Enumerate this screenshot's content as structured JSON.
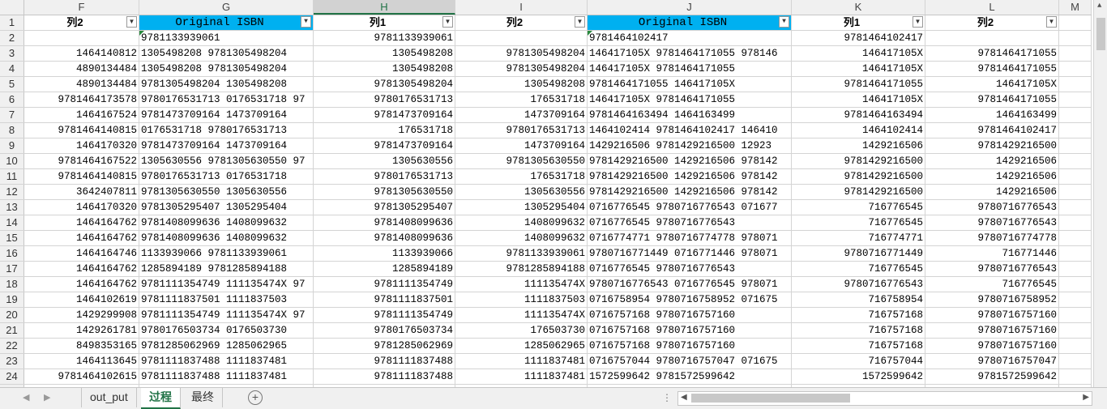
{
  "columns": [
    "F",
    "G",
    "H",
    "I",
    "J",
    "K",
    "L",
    "M"
  ],
  "selected_column": "H",
  "header_row": [
    "列2",
    "Original ISBN",
    "列1",
    "列2",
    "Original ISBN",
    "列1",
    "列2",
    ""
  ],
  "rows": [
    [
      "",
      "9781133939061",
      "9781133939061",
      "",
      "9781464102417",
      "9781464102417",
      ""
    ],
    [
      "1464140812",
      "1305498208  9781305498204",
      "1305498208",
      "9781305498204",
      "146417105X  9781464171055  978146",
      "146417105X",
      "9781464171055"
    ],
    [
      "4890134484",
      "1305498208  9781305498204",
      "1305498208",
      "9781305498204",
      "146417105X  9781464171055",
      "146417105X",
      "9781464171055"
    ],
    [
      "4890134484",
      "9781305498204  1305498208",
      "9781305498204",
      "1305498208",
      "9781464171055  146417105X",
      "9781464171055",
      "146417105X"
    ],
    [
      "9781464173578",
      "9780176531713  0176531718  97",
      "9780176531713",
      "176531718",
      "146417105X  9781464171055",
      "146417105X",
      "9781464171055"
    ],
    [
      "1464167524",
      "9781473709164  1473709164",
      "9781473709164",
      "1473709164",
      "9781464163494  1464163499",
      "9781464163494",
      "1464163499"
    ],
    [
      "9781464140815",
      "0176531718  9780176531713",
      "176531718",
      "9780176531713",
      "1464102414  9781464102417  146410",
      "1464102414",
      "9781464102417"
    ],
    [
      "1464170320",
      "9781473709164  1473709164",
      "9781473709164",
      "1473709164",
      "1429216506  9781429216500  12923",
      "1429216506",
      "9781429216500"
    ],
    [
      "9781464167522",
      "1305630556  9781305630550  97",
      "1305630556",
      "9781305630550",
      "9781429216500  1429216506  978142",
      "9781429216500",
      "1429216506"
    ],
    [
      "9781464140815",
      "9780176531713  0176531718",
      "9780176531713",
      "176531718",
      "9781429216500  1429216506  978142",
      "9781429216500",
      "1429216506"
    ],
    [
      "3642407811",
      "9781305630550  1305630556",
      "9781305630550",
      "1305630556",
      "9781429216500  1429216506  978142",
      "9781429216500",
      "1429216506"
    ],
    [
      "1464170320",
      "9781305295407  1305295404",
      "9781305295407",
      "1305295404",
      "0716776545  9780716776543  071677",
      "716776545",
      "9780716776543"
    ],
    [
      "1464164762",
      "9781408099636  1408099632",
      "9781408099636",
      "1408099632",
      "0716776545  9780716776543",
      "716776545",
      "9780716776543"
    ],
    [
      "1464164762",
      "9781408099636  1408099632",
      "9781408099636",
      "1408099632",
      "0716774771  9780716774778  978071",
      "716774771",
      "9780716774778"
    ],
    [
      "1464164746",
      "1133939066  9781133939061",
      "1133939066",
      "9781133939061",
      "9780716771449  0716771446  978071",
      "9780716771449",
      "716771446"
    ],
    [
      "1464164762",
      "1285894189  9781285894188",
      "1285894189",
      "9781285894188",
      "0716776545  9780716776543",
      "716776545",
      "9780716776543"
    ],
    [
      "1464164762",
      "9781111354749  111135474X  97",
      "9781111354749",
      "111135474X",
      "9780716776543  0716776545  978071",
      "9780716776543",
      "716776545"
    ],
    [
      "1464102619",
      "9781111837501  1111837503",
      "9781111837501",
      "1111837503",
      "0716758954  9780716758952  071675",
      "716758954",
      "9780716758952"
    ],
    [
      "1429299908",
      "9781111354749  111135474X  97",
      "9781111354749",
      "111135474X",
      "0716757168  9780716757160",
      "716757168",
      "9780716757160"
    ],
    [
      "1429261781",
      "9780176503734  0176503730",
      "9780176503734",
      "176503730",
      "0716757168  9780716757160",
      "716757168",
      "9780716757160"
    ],
    [
      "8498353165",
      "9781285062969  1285062965",
      "9781285062969",
      "1285062965",
      "0716757168  9780716757160",
      "716757168",
      "9780716757160"
    ],
    [
      "1464113645",
      "9781111837488  1111837481",
      "9781111837488",
      "1111837481",
      "0716757044  9780716757047  071675",
      "716757044",
      "9780716757047"
    ],
    [
      "9781464102615",
      "9781111837488  1111837481",
      "9781111837488",
      "1111837481",
      "1572599642  9781572599642",
      "1572599642",
      "9781572599642"
    ],
    [
      "1464102619",
      "9781111837488  1111837481",
      "9781111837488",
      "1111837481",
      "1572599642  9781572599642",
      "1572599642",
      "9781572599642"
    ]
  ],
  "sheet_tabs": [
    "out_put",
    "过程",
    "最终"
  ],
  "active_tab": "过程",
  "icons": {
    "dropdown": "filter-dropdown-icon",
    "add_sheet": "add-sheet-icon"
  },
  "colors": {
    "header_highlight": "#00b0f0",
    "excel_green": "#217346"
  }
}
